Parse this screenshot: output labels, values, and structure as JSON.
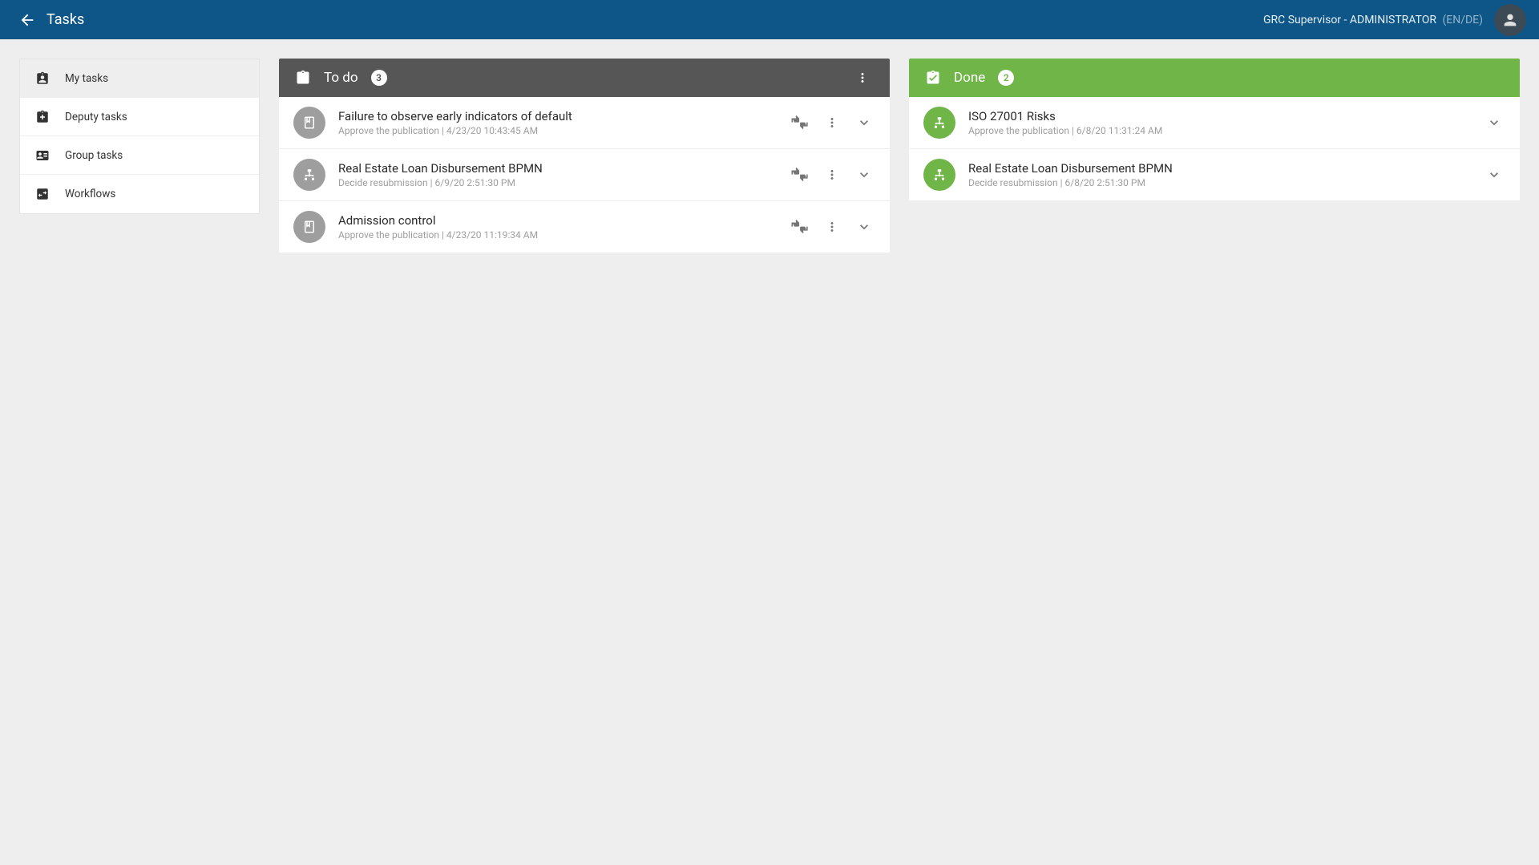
{
  "header": {
    "title": "Tasks",
    "user_role": "GRC Supervisor - ADMINISTRATOR",
    "user_lang": "(EN/DE)"
  },
  "sidebar": {
    "items": [
      {
        "label": "My tasks",
        "active": true,
        "icon": "clipboard-user"
      },
      {
        "label": "Deputy tasks",
        "active": false,
        "icon": "clipboard-plus"
      },
      {
        "label": "Group tasks",
        "active": false,
        "icon": "contact-card"
      },
      {
        "label": "Workflows",
        "active": false,
        "icon": "arrows-box"
      }
    ]
  },
  "columns": {
    "todo": {
      "title": "To do",
      "count": "3",
      "tasks": [
        {
          "title": "Failure to observe early indicators of default",
          "subtitle": "Approve the publication | 4/23/20 10:43:45 AM",
          "icon": "book",
          "color": "gray"
        },
        {
          "title": "Real Estate Loan Disbursement BPMN",
          "subtitle": "Decide resubmission | 6/9/20 2:51:30 PM",
          "icon": "sitemap",
          "color": "gray"
        },
        {
          "title": "Admission control",
          "subtitle": "Approve the publication | 4/23/20 11:19:34 AM",
          "icon": "book",
          "color": "gray"
        }
      ]
    },
    "done": {
      "title": "Done",
      "count": "2",
      "tasks": [
        {
          "title": "ISO 27001 Risks",
          "subtitle": "Approve the publication | 6/8/20 11:31:24 AM",
          "icon": "sitemap",
          "color": "green"
        },
        {
          "title": "Real Estate Loan Disbursement BPMN",
          "subtitle": "Decide resubmission | 6/8/20 2:51:30 PM",
          "icon": "sitemap",
          "color": "green"
        }
      ]
    }
  }
}
